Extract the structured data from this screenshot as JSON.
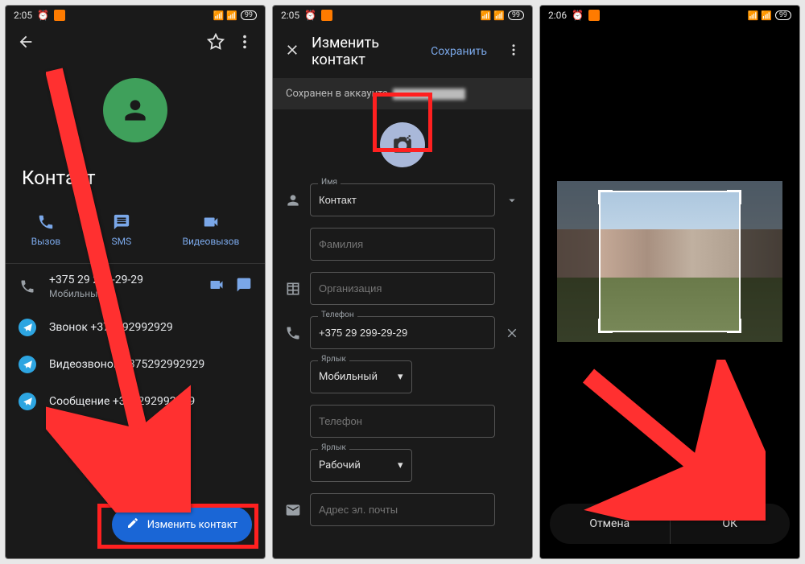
{
  "screen1": {
    "time": "2:05",
    "battery": "99",
    "contact_name": "Контакт",
    "actions": {
      "call": "Вызов",
      "sms": "SMS",
      "video": "Видеовызов"
    },
    "phone_number": "+375 29 299-29-29",
    "phone_type": "Мобильный",
    "tg_call": "Звонок +375292992929",
    "tg_video": "Видеозвонок +375292992929",
    "tg_msg": "Сообщение +375292992929",
    "edit_button": "Изменить контакт"
  },
  "screen2": {
    "time": "2:05",
    "battery": "99",
    "title": "Изменить контакт",
    "save": "Сохранить",
    "account_label": "Сохранен в аккаунте",
    "name_lbl": "Имя",
    "name_val": "Контакт",
    "surname_ph": "Фамилия",
    "org_ph": "Организация",
    "phone_lbl": "Телефон",
    "phone_val": "+375 29 299-29-29",
    "tag_lbl": "Ярлык",
    "tag_mobile": "Мобильный",
    "phone2_ph": "Телефон",
    "tag2_lbl": "Ярлык",
    "tag_work": "Рабочий",
    "email_ph": "Адрес эл. почты"
  },
  "screen3": {
    "time": "2:06",
    "battery": "99",
    "cancel": "Отмена",
    "ok": "ОК"
  }
}
